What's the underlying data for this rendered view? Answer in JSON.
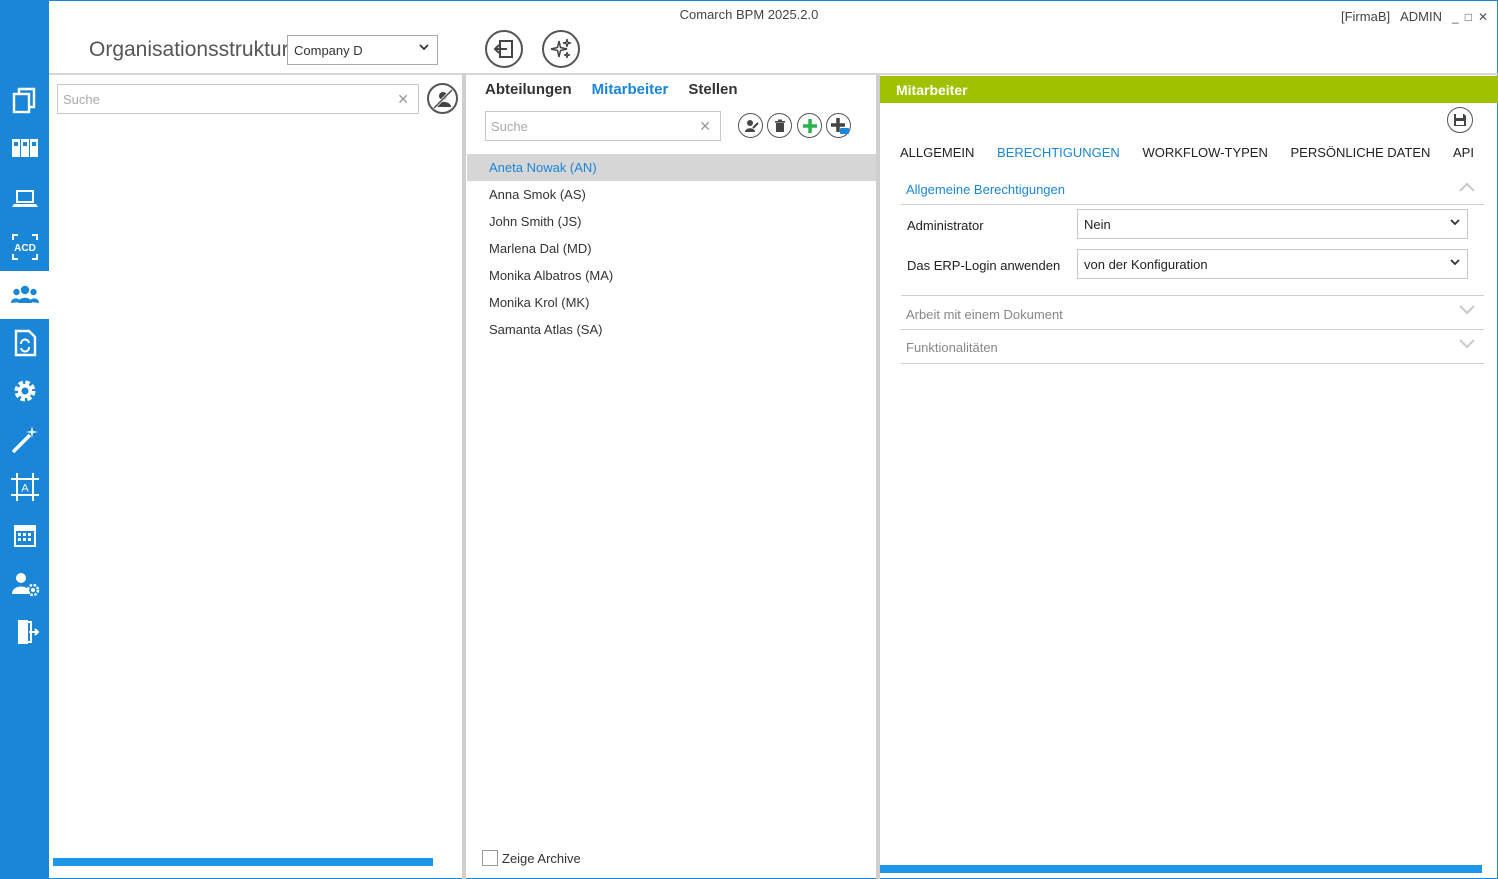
{
  "window": {
    "title": "Comarch BPM 2025.2.0",
    "company_tag": "[FirmaB]",
    "user": "ADMIN",
    "minimize_glyph": "_",
    "maximize_glyph": "□",
    "close_glyph": "✕"
  },
  "nav": {
    "items": [
      {
        "icon": "documents-icon",
        "active": false
      },
      {
        "icon": "binders-icon",
        "active": false
      },
      {
        "icon": "laptop-icon",
        "active": false
      },
      {
        "icon": "acd-icon",
        "active": false
      },
      {
        "icon": "users-group-icon",
        "active": true
      },
      {
        "icon": "document-sync-icon",
        "active": false
      },
      {
        "icon": "gear-icon",
        "active": false
      },
      {
        "icon": "magic-wand-icon",
        "active": false
      },
      {
        "icon": "frame-a-icon",
        "active": false
      },
      {
        "icon": "calendar-icon",
        "active": false
      },
      {
        "icon": "user-settings-icon",
        "active": false
      },
      {
        "icon": "exit-door-icon",
        "active": false
      }
    ]
  },
  "header": {
    "title": "Organisationsstruktur",
    "company_select": "Company D"
  },
  "left_pane": {
    "search_placeholder": "Suche",
    "clear_glyph": "✕"
  },
  "middle_pane": {
    "tabs": [
      {
        "label": "Abteilungen",
        "active": false
      },
      {
        "label": "Mitarbeiter",
        "active": true
      },
      {
        "label": "Stellen",
        "active": false
      }
    ],
    "search_placeholder": "Suche",
    "clear_glyph": "✕",
    "employees": [
      {
        "label": "Aneta Nowak (AN)",
        "selected": true
      },
      {
        "label": "Anna Smok (AS)",
        "selected": false
      },
      {
        "label": "John Smith (JS)",
        "selected": false
      },
      {
        "label": "Marlena Dal (MD)",
        "selected": false
      },
      {
        "label": "Monika Albatros (MA)",
        "selected": false
      },
      {
        "label": "Monika Krol (MK)",
        "selected": false
      },
      {
        "label": "Samanta Atlas (SA)",
        "selected": false
      }
    ],
    "archive_label": "Zeige Archive"
  },
  "right_pane": {
    "header": "Mitarbeiter",
    "tabs": [
      {
        "label": "ALLGEMEIN",
        "active": false
      },
      {
        "label": "BERECHTIGUNGEN",
        "active": true
      },
      {
        "label": "WORKFLOW-TYPEN",
        "active": false
      },
      {
        "label": "PERSÖNLICHE DATEN",
        "active": false
      },
      {
        "label": "API",
        "active": false
      }
    ],
    "sections": {
      "general": "Allgemeine Berechtigungen",
      "document": "Arbeit mit einem Dokument",
      "functions": "Funktionalitäten"
    },
    "fields": {
      "administrator_label": "Administrator",
      "administrator_value": "Nein",
      "erp_login_label": "Das ERP-Login anwenden",
      "erp_login_value": "von der Konfiguration"
    }
  },
  "colors": {
    "nav_blue": "#1a86d8",
    "header_green": "#a0c100",
    "accent_blue": "#1a86d8",
    "add_green": "#2bb24c",
    "selection_grey": "#d6d6d6"
  }
}
